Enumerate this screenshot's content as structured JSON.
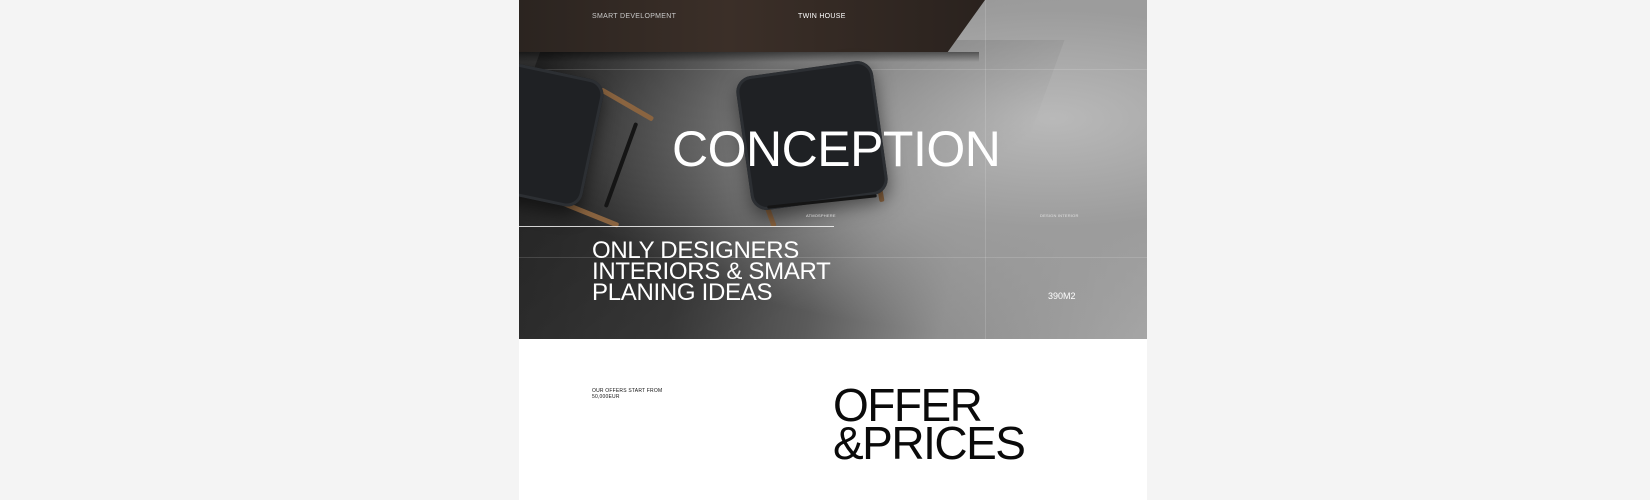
{
  "nav": {
    "left": "SMART DEVELOPMENT",
    "right": "TWIN HOUSE"
  },
  "hero": {
    "title": "CONCEPTION",
    "label_left": "ATMOSPHERE",
    "label_right": "DESIGN INTERIOR",
    "tagline_lines": [
      "ONLY DESIGNERS",
      "INTERIORS & SMART",
      "PLANING IDEAS"
    ],
    "area": "390M2"
  },
  "offer": {
    "note_lines": [
      "OUR OFFERS START FROM",
      "50,000EUR"
    ],
    "title_lines": [
      "OFFER",
      "&PRICES"
    ]
  }
}
